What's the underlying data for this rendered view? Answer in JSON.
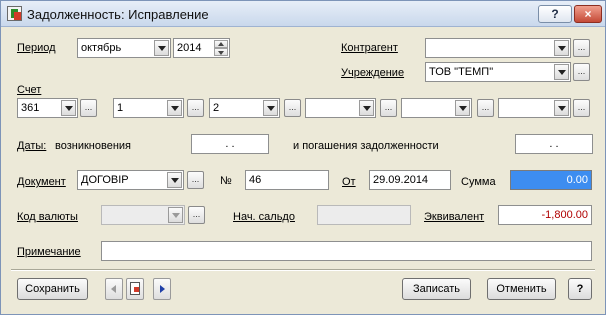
{
  "window": {
    "title": "Задолженность: Исправление",
    "help_button": "?",
    "close_button": "×"
  },
  "period": {
    "label": "Период",
    "month": "октябрь",
    "year": "2014"
  },
  "counterparty": {
    "label": "Контрагент",
    "value": ""
  },
  "institution": {
    "label": "Учреждение",
    "value": "ТОВ \"ТЕМП\""
  },
  "account": {
    "label": "Счет",
    "values": [
      "361",
      "1",
      "2",
      "",
      "",
      ""
    ]
  },
  "dates": {
    "label": "Даты:",
    "origin_label": "возникновения",
    "origin_value": ". .",
    "repay_label": "и погашения задолженности",
    "repay_value": ". ."
  },
  "document": {
    "label": "Документ",
    "type": "ДОГОВІР",
    "number_label": "№",
    "number": "46",
    "date_label": "От",
    "date": "29.09.2014",
    "sum_label": "Сумма",
    "sum": "0.00"
  },
  "currency": {
    "label": "Код валюты",
    "value": "",
    "start_balance_label": "Нач. сальдо",
    "start_balance": "",
    "equivalent_label": "Эквивалент",
    "equivalent": "-1,800.00"
  },
  "note": {
    "label": "Примечание",
    "value": ""
  },
  "buttons": {
    "save": "Сохранить",
    "record": "Записать",
    "cancel": "Отменить",
    "help": "?",
    "ellipsis": "..."
  },
  "colors": {
    "selection": "#3d8df0",
    "negative": "#b00000"
  }
}
